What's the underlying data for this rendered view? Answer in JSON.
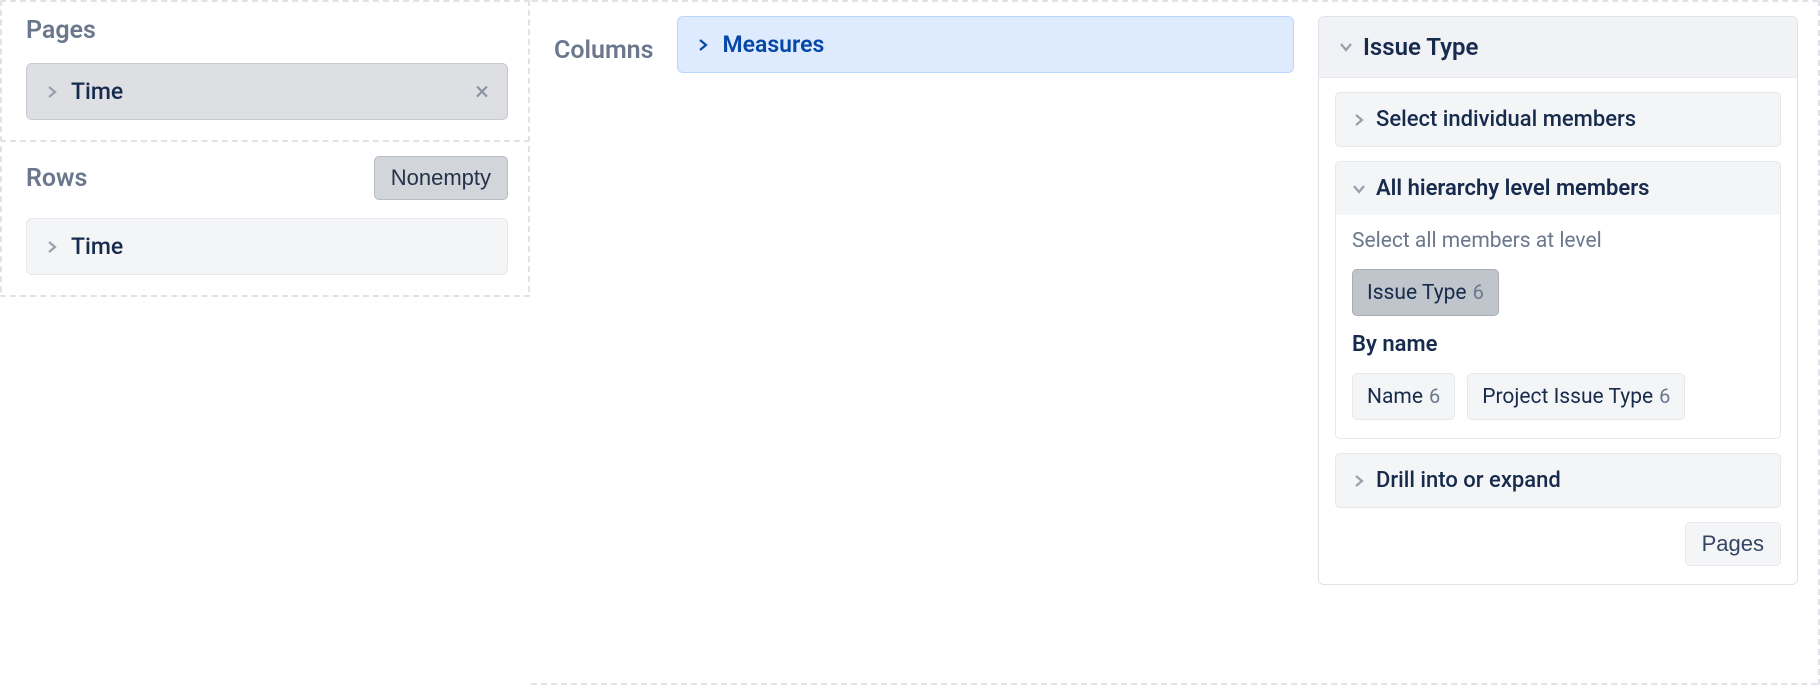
{
  "pages": {
    "title": "Pages",
    "item": "Time"
  },
  "rows": {
    "title": "Rows",
    "nonempty_label": "Nonempty",
    "item": "Time"
  },
  "columns": {
    "title": "Columns",
    "measures_label": "Measures",
    "panel": {
      "title": "Issue Type",
      "select_individual": "Select individual members",
      "hierarchy_section": {
        "title": "All hierarchy level members",
        "help": "Select all members at level",
        "level_tag": {
          "label": "Issue Type",
          "count": "6"
        },
        "by_name_title": "By name",
        "name_tags": [
          {
            "label": "Name",
            "count": "6"
          },
          {
            "label": "Project Issue Type",
            "count": "6"
          }
        ]
      },
      "drill_label": "Drill into or expand",
      "footer_button": "Pages"
    }
  }
}
